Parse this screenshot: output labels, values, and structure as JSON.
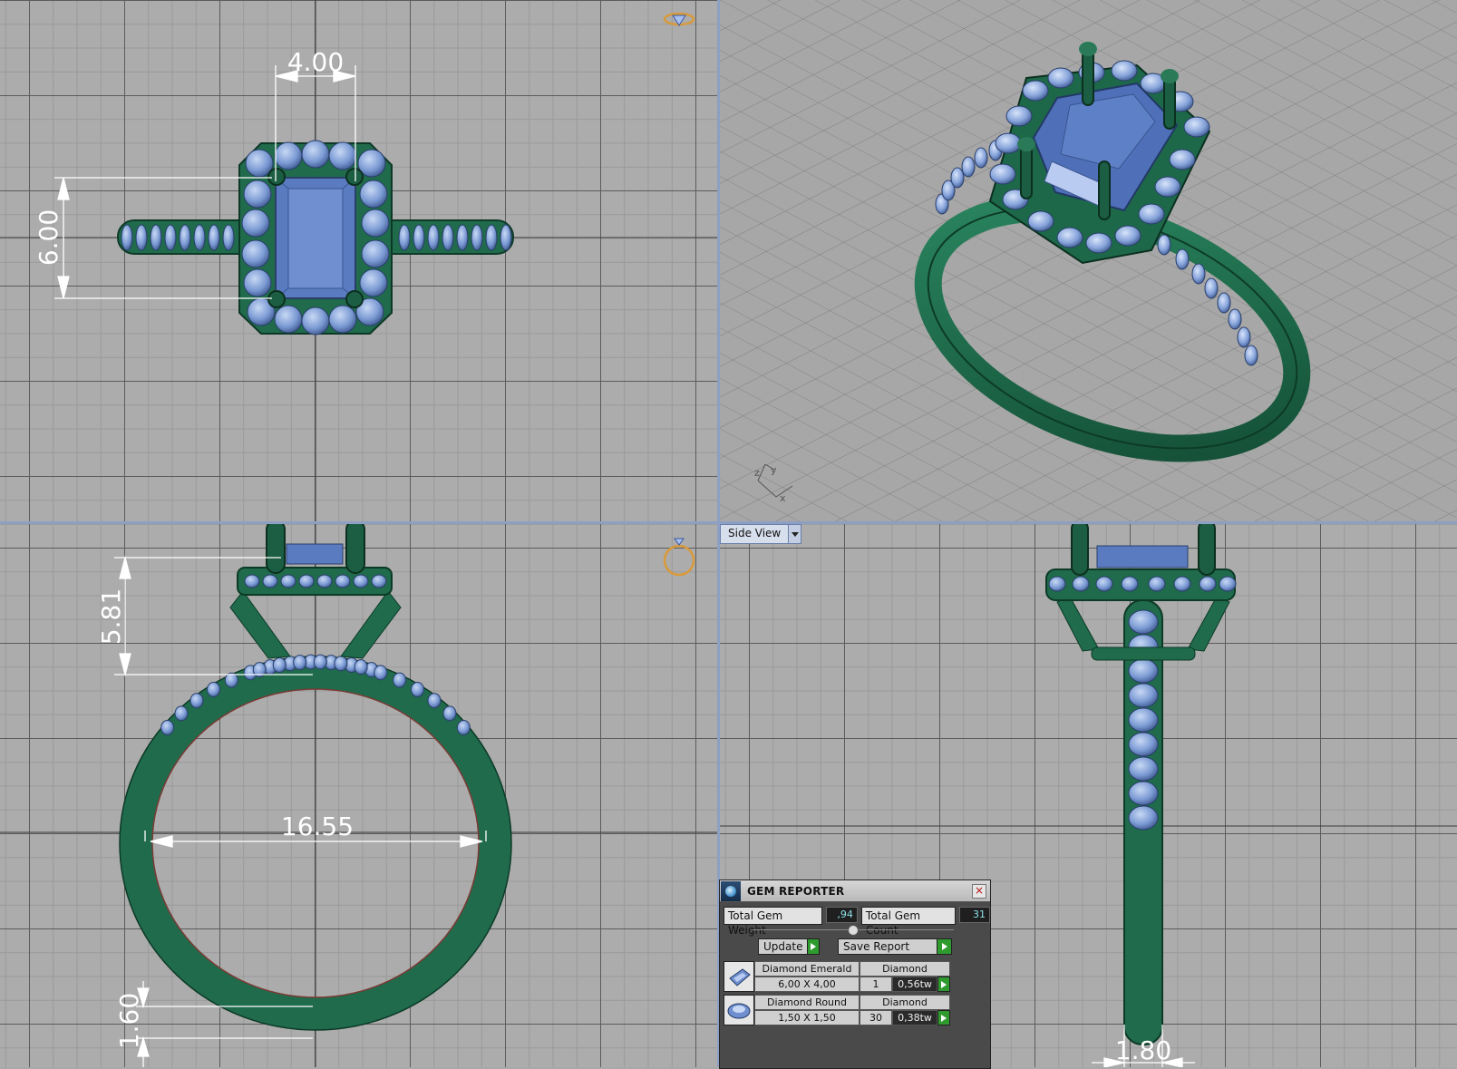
{
  "viewports": {
    "top": {
      "dim_width": "4.00",
      "dim_height": "6.00"
    },
    "perspective": {
      "axis_x": "x",
      "axis_y": "y",
      "axis_z": "z"
    },
    "front": {
      "dim_height": "5.81",
      "dim_diameter": "16.55",
      "dim_band": "1.60"
    },
    "side": {
      "view_label": "Side View",
      "dim_width": "1.80"
    }
  },
  "gem_reporter": {
    "title": "GEM REPORTER",
    "total_weight_label": "Total Gem Weight",
    "total_weight_value": ",94",
    "total_count_label": "Total Gem Count",
    "total_count_value": "31",
    "update_label": "Update",
    "save_report_label": "Save Report",
    "gems": [
      {
        "name": "Diamond Emerald",
        "material": "Diamond",
        "size": "6,00 X 4,00",
        "count": "1",
        "weight": "0,56tw"
      },
      {
        "name": "Diamond Round",
        "material": "Diamond",
        "size": "1,50 X 1,50",
        "count": "30",
        "weight": "0,38tw"
      }
    ]
  },
  "colors": {
    "metal": "#1f6b4c",
    "gem": "#5a7bc0",
    "accent": "#8da0c4"
  }
}
